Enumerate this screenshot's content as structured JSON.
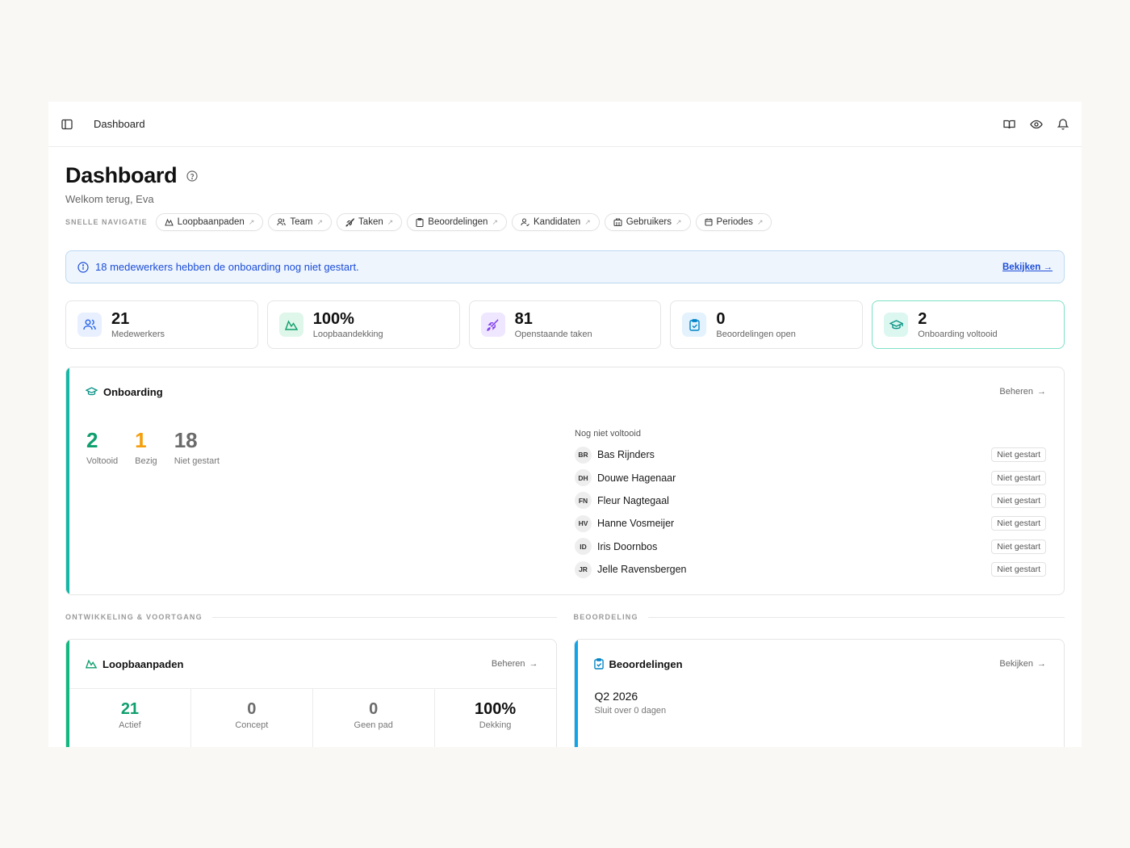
{
  "topbar": {
    "breadcrumb": "Dashboard"
  },
  "header": {
    "title": "Dashboard",
    "subtitle": "Welkom terug, Eva"
  },
  "quicknav": {
    "label": "SNELLE NAVIGATIE",
    "items": [
      "Loopbaanpaden",
      "Team",
      "Taken",
      "Beoordelingen",
      "Kandidaten",
      "Gebruikers",
      "Periodes"
    ]
  },
  "banner": {
    "text": "18 medewerkers hebben de onboarding nog niet gestart.",
    "link": "Bekijken →"
  },
  "stats": [
    {
      "value": "21",
      "label": "Medewerkers"
    },
    {
      "value": "100%",
      "label": "Loopbaandekking"
    },
    {
      "value": "81",
      "label": "Openstaande taken"
    },
    {
      "value": "0",
      "label": "Beoordelingen open"
    },
    {
      "value": "2",
      "label": "Onboarding voltooid"
    }
  ],
  "onboarding": {
    "title": "Onboarding",
    "action": "Beheren",
    "counts": [
      {
        "value": "2",
        "label": "Voltooid"
      },
      {
        "value": "1",
        "label": "Bezig"
      },
      {
        "value": "18",
        "label": "Niet gestart"
      }
    ],
    "list_header": "Nog niet voltooid",
    "people": [
      {
        "initials": "BR",
        "name": "Bas Rijnders",
        "status": "Niet gestart"
      },
      {
        "initials": "DH",
        "name": "Douwe Hagenaar",
        "status": "Niet gestart"
      },
      {
        "initials": "FN",
        "name": "Fleur Nagtegaal",
        "status": "Niet gestart"
      },
      {
        "initials": "HV",
        "name": "Hanne Vosmeijer",
        "status": "Niet gestart"
      },
      {
        "initials": "ID",
        "name": "Iris Doornbos",
        "status": "Niet gestart"
      },
      {
        "initials": "JR",
        "name": "Jelle Ravensbergen",
        "status": "Niet gestart"
      }
    ]
  },
  "sections": {
    "left": "ONTWIKKELING & VOORTGANG",
    "right": "BEOORDELING"
  },
  "loopbaanpaden": {
    "title": "Loopbaanpaden",
    "action": "Beheren",
    "metrics": [
      {
        "value": "21",
        "label": "Actief"
      },
      {
        "value": "0",
        "label": "Concept"
      },
      {
        "value": "0",
        "label": "Geen pad"
      },
      {
        "value": "100%",
        "label": "Dekking"
      }
    ]
  },
  "beoordelingen": {
    "title": "Beoordelingen",
    "action": "Bekijken",
    "period": "Q2 2026",
    "period_sub": "Sluit over 0 dagen"
  },
  "colors": {
    "green": "#0f9f6e",
    "orange": "#f59e0b",
    "gray": "#6b6b6b",
    "blue": "#1d4ed8",
    "teal_accent": "#14b8a6",
    "sky_accent": "#0ea5e9"
  }
}
